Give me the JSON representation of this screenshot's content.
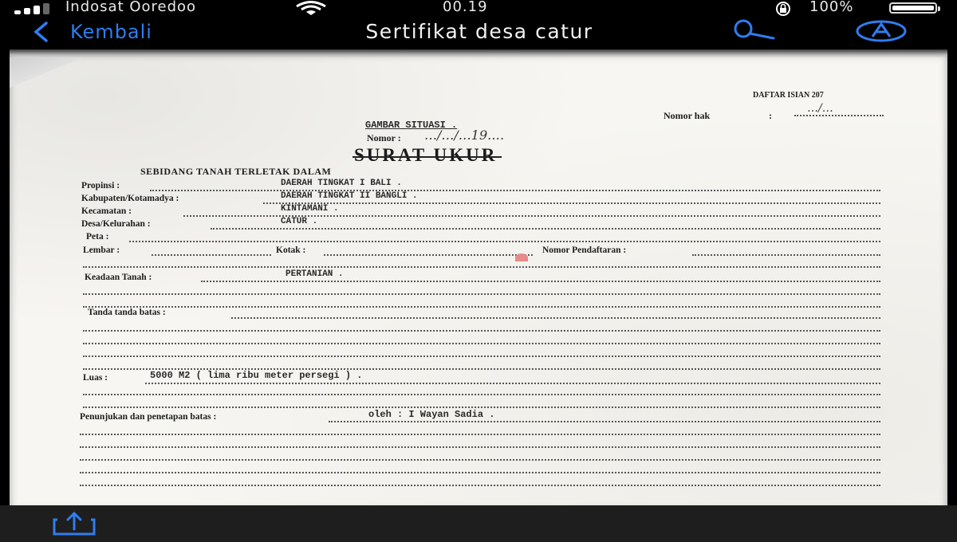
{
  "status_bar": {
    "carrier": "Indosat Ooredoo",
    "time": "00.19",
    "battery": "100%",
    "battery_level": 1.0,
    "icons": [
      "signal-icon",
      "wifi-icon",
      "orientation-lock-icon",
      "battery-icon"
    ]
  },
  "nav": {
    "back_label": "Kembali",
    "title": "Sertifikat desa catur",
    "icons": [
      "chevron-left-icon",
      "search-icon",
      "markup-icon"
    ]
  },
  "document": {
    "form_code": "DAFTAR ISIAN 207",
    "nomor_hak_label": "Nomor hak",
    "nomor_hak_colon": ":",
    "nomor_hak_value": "…/…",
    "gambar_situasi": "GAMBAR SITUASI .",
    "nomor_label": "Nomor :",
    "nomor_value": "…/…/…19.…",
    "title": "SURAT UKUR",
    "subtitle": "SEBIDANG TANAH TERLETAK DALAM",
    "propinsi_label": "Propinsi :",
    "propinsi_value": "DAERAH TINGKAT I BALI .",
    "kabupaten_label": "Kabupaten/Kotamadya :",
    "kabupaten_value": "DAERAH TINGKAT II BANGLI .",
    "kecamatan_label": "Kecamatan :",
    "kecamatan_value": "KINTAMANI .",
    "desa_label": "Desa/Kelurahan :",
    "desa_value": "CATUR .",
    "peta_label": "Peta :",
    "lembar_label": "Lembar :",
    "kotak_label": "Kotak :",
    "nomor_pendaftaran_label": "Nomor Pendaftaran :",
    "keadaan_label": "Keadaan Tanah :",
    "keadaan_value": "PERTANIAN .",
    "tanda_label": "Tanda tanda batas :",
    "luas_label": "Luas :",
    "luas_value": "5000 M2 ( lima ribu meter persegi ) .",
    "penunjukan_label": "Penunjukan dan penetapan batas :",
    "penunjukan_value": "oleh : I Wayan Sadia ."
  },
  "toolbar": {
    "icons": [
      "share-icon"
    ]
  }
}
